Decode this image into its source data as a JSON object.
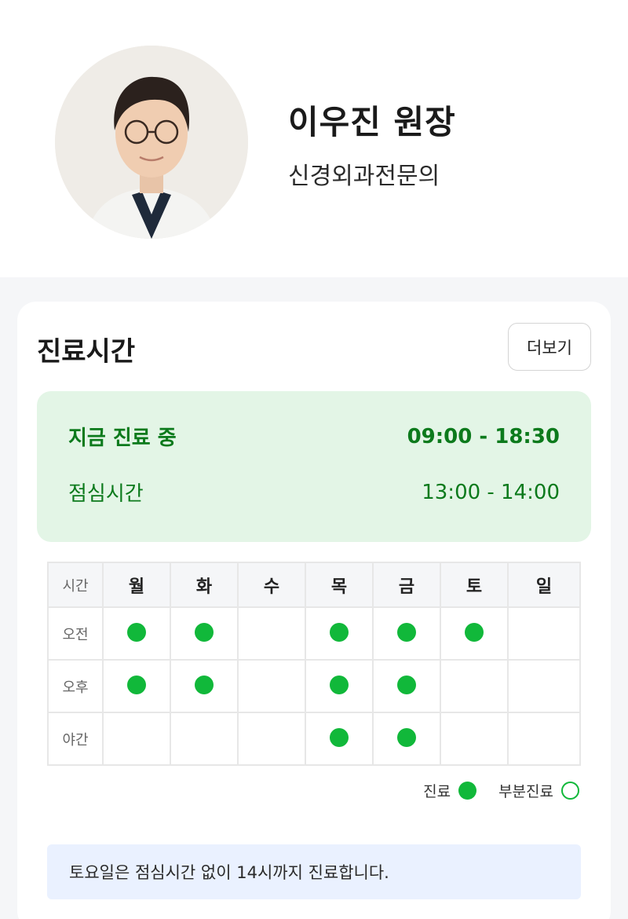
{
  "doctor": {
    "name": "이우진 원장",
    "specialty": "신경외과전문의"
  },
  "hours": {
    "title": "진료시간",
    "more_label": "더보기",
    "status": {
      "label": "지금 진료 중",
      "time": "09:00 - 18:30"
    },
    "lunch": {
      "label": "점심시간",
      "time": "13:00 - 14:00"
    }
  },
  "schedule": {
    "corner_label": "시간",
    "days": [
      "월",
      "화",
      "수",
      "목",
      "금",
      "토",
      "일"
    ],
    "rows": [
      {
        "label": "오전",
        "open": [
          true,
          true,
          false,
          true,
          true,
          true,
          false
        ]
      },
      {
        "label": "오후",
        "open": [
          true,
          true,
          false,
          true,
          true,
          false,
          false
        ]
      },
      {
        "label": "야간",
        "open": [
          false,
          false,
          false,
          true,
          true,
          false,
          false
        ]
      }
    ],
    "legend": {
      "full": "진료",
      "partial": "부분진료"
    }
  },
  "note": "토요일은 점심시간 없이 14시까지 진료합니다.",
  "colors": {
    "accent_green": "#11b83a",
    "status_text": "#0c7a1c",
    "status_bg": "#e3f5e6",
    "note_bg": "#eaf1ff"
  }
}
